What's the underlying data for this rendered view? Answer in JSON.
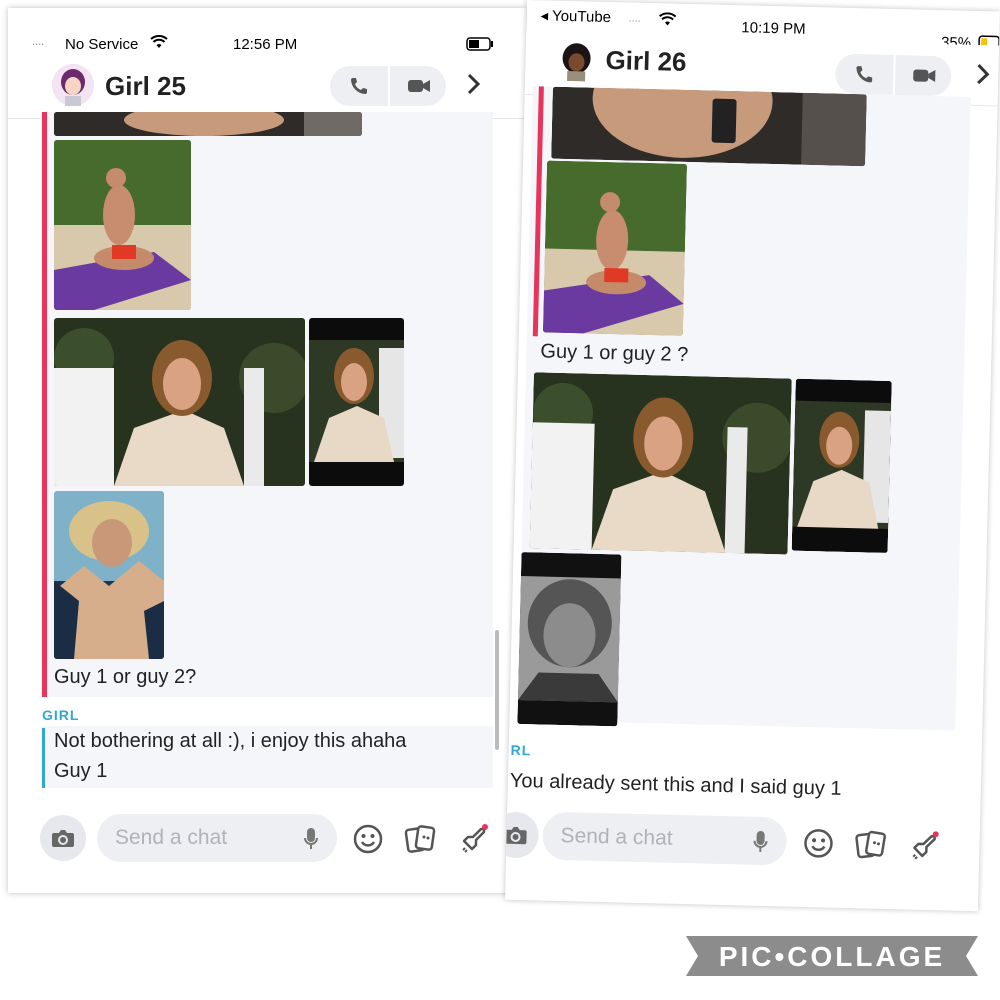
{
  "left": {
    "status": {
      "carrier": "No Service",
      "time": "12:56 PM"
    },
    "header": {
      "title": "Girl 25"
    },
    "messages": {
      "caption": "Guy 1 or guy 2?",
      "reply_sender": "GIRL",
      "reply_line1": "Not bothering at all :), i enjoy this ahaha",
      "reply_line2": "Guy 1"
    },
    "input": {
      "placeholder": "Send a chat"
    }
  },
  "right": {
    "status": {
      "back_app": "YouTube",
      "time": "10:19 PM",
      "battery": "35%"
    },
    "header": {
      "title": "Girl 26"
    },
    "messages": {
      "caption": "Guy 1 or guy 2 ?",
      "reply_sender": "RL",
      "reply_text": "You already sent this and I said guy 1"
    },
    "input": {
      "placeholder": "Send a chat"
    }
  },
  "watermark": {
    "text": "PIC•COLLAGE"
  },
  "colors": {
    "accent_red": "#e8345a",
    "accent_blue": "#2fa8d6",
    "chat_bg": "#f5f6fa"
  },
  "icons": [
    "wifi-icon",
    "battery-icon",
    "phone-icon",
    "video-icon",
    "chevron-right-icon",
    "camera-icon",
    "mic-icon",
    "emoji-icon",
    "stickers-icon",
    "rocket-icon"
  ]
}
